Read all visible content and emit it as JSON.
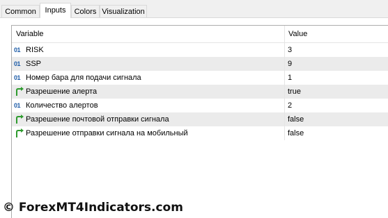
{
  "tabs": [
    {
      "label": "Common",
      "active": false
    },
    {
      "label": "Inputs",
      "active": true
    },
    {
      "label": "Colors",
      "active": false
    },
    {
      "label": "Visualization",
      "active": false
    }
  ],
  "table": {
    "columns": [
      "Variable",
      "Value"
    ],
    "rows": [
      {
        "icon": "int-type-icon",
        "name": "RISK",
        "value": "3"
      },
      {
        "icon": "int-type-icon",
        "name": "SSP",
        "value": "9"
      },
      {
        "icon": "int-type-icon",
        "name": "Номер бара для подачи сигнала",
        "value": "1"
      },
      {
        "icon": "bool-type-icon",
        "name": "Разрешение алерта",
        "value": "true"
      },
      {
        "icon": "int-type-icon",
        "name": "Количество алертов",
        "value": "2"
      },
      {
        "icon": "bool-type-icon",
        "name": "Разрешение почтовой отправки сигнала",
        "value": "false"
      },
      {
        "icon": "bool-type-icon",
        "name": "Разрешение отправки сигнала на мобильный",
        "value": "false"
      }
    ]
  },
  "watermark": "© ForexMT4Indicators.com",
  "colors": {
    "int_icon": "#1f5da8",
    "bool_icon_arrow": "#2e9b2e",
    "row_alt": "#ebebeb"
  }
}
